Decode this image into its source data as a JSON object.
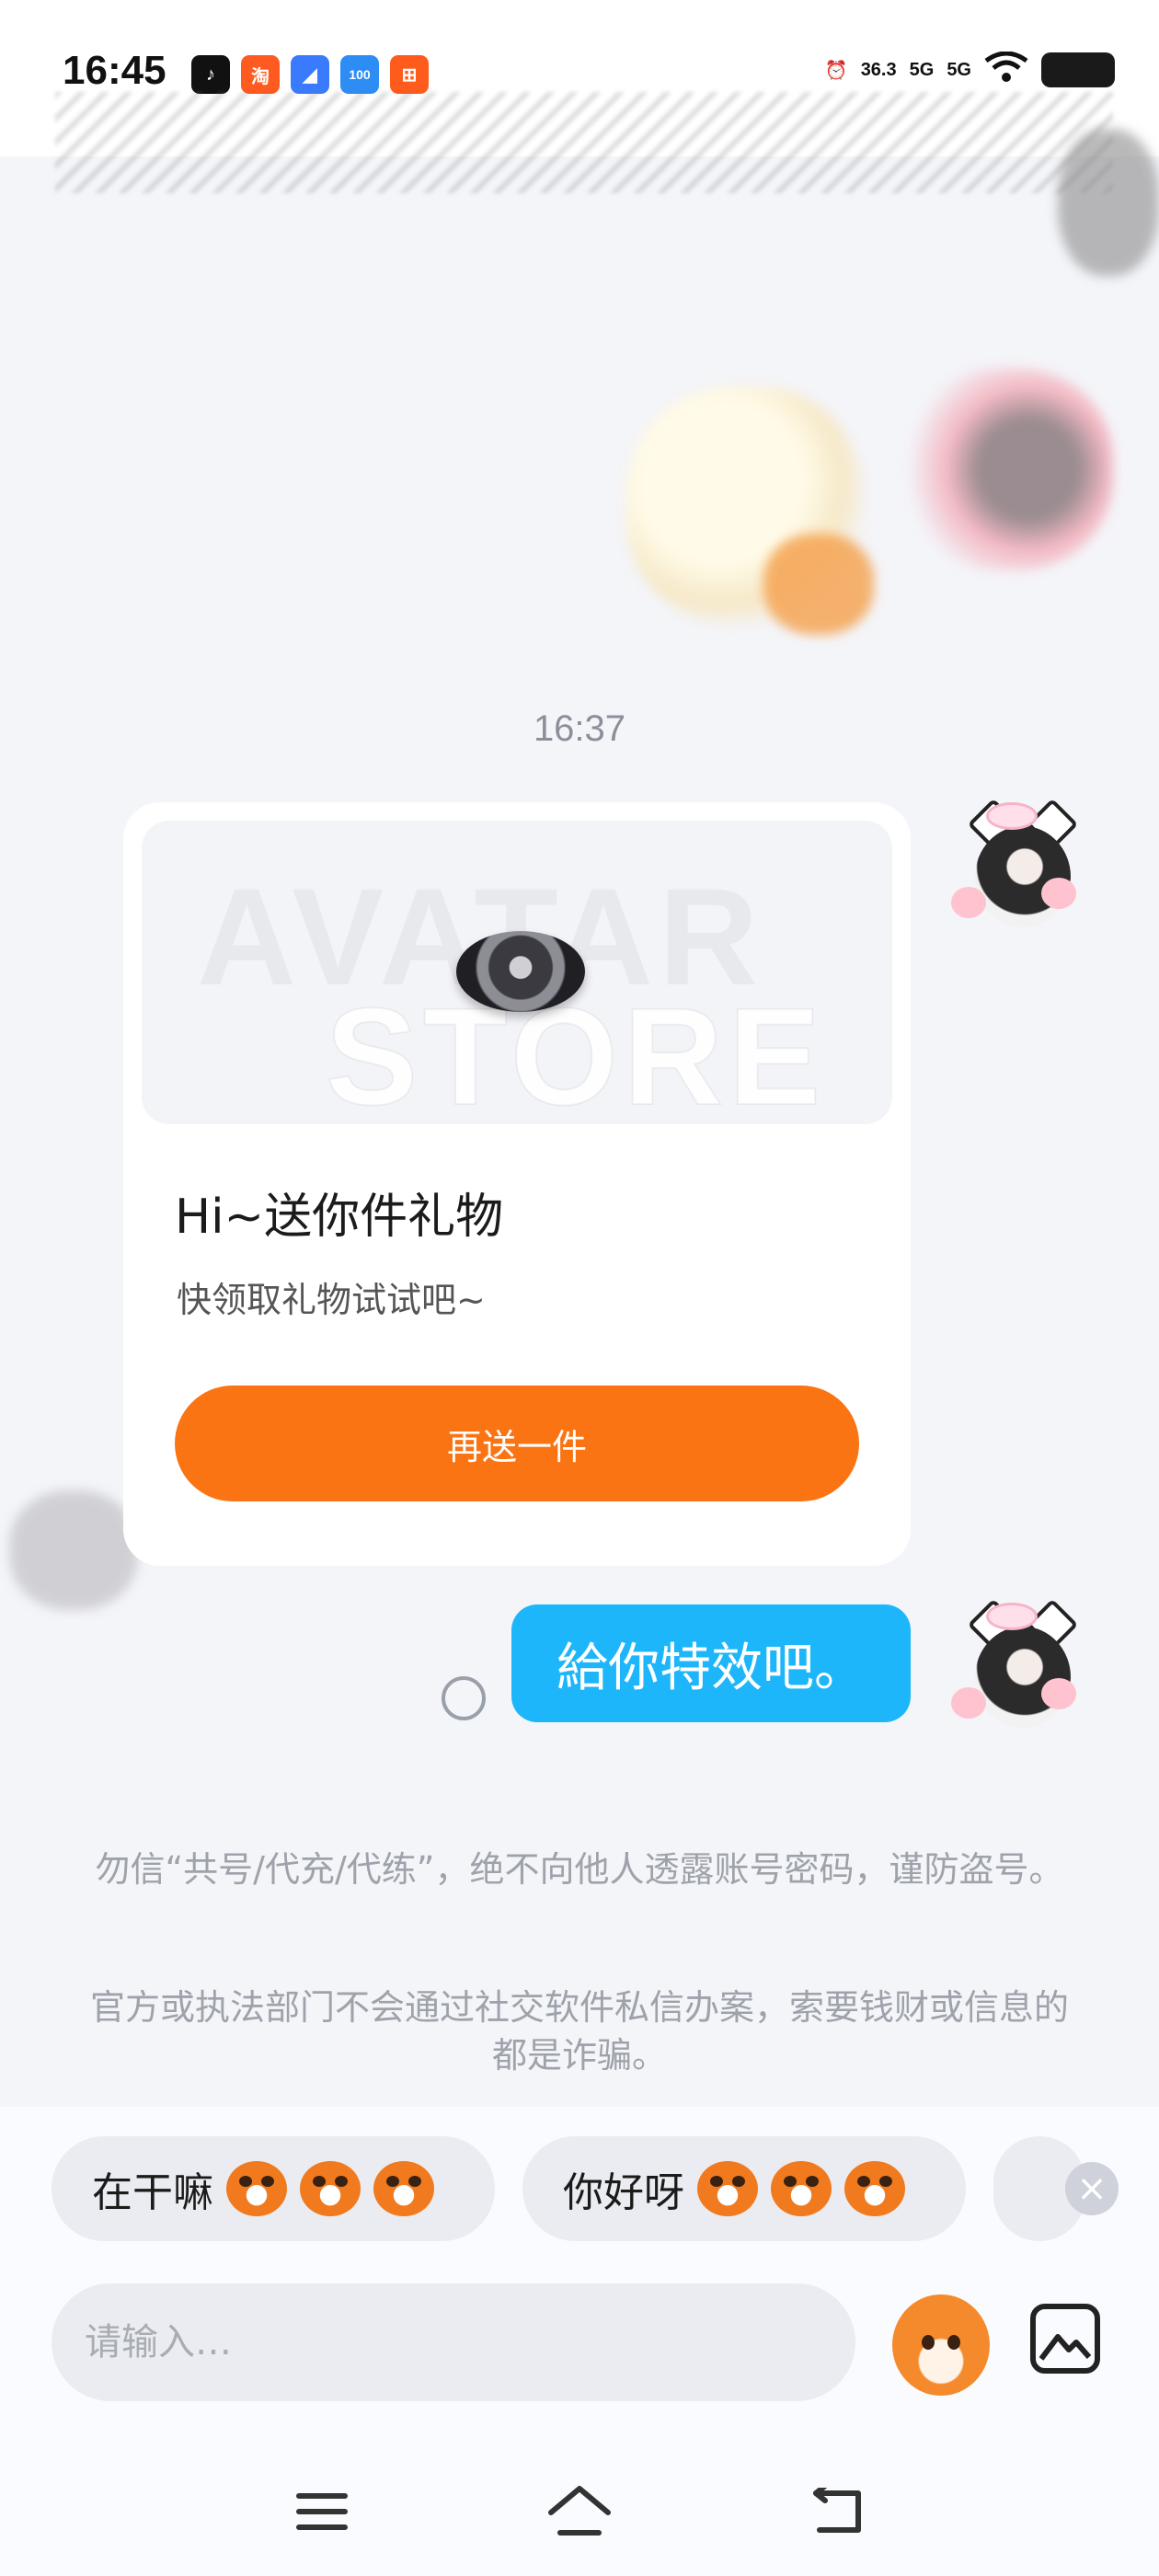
{
  "status_bar": {
    "time": "16:45",
    "app_icons": [
      {
        "name": "tiktok-icon",
        "glyph": "♪",
        "color": "#111111"
      },
      {
        "name": "taobao-icon",
        "glyph": "淘",
        "color": "#ff5a1f"
      },
      {
        "name": "blue-app-icon",
        "glyph": "◢",
        "color": "#3a7bfd"
      },
      {
        "name": "homework-app-icon",
        "glyph": "100",
        "color": "#2e8df5"
      },
      {
        "name": "orange-app-icon",
        "glyph": "⊞",
        "color": "#ff5b1c"
      }
    ],
    "network_speed": "36.3",
    "signal_1": "5G",
    "signal_2": "5G"
  },
  "chat": {
    "timestamp": "16:37",
    "gift_card": {
      "preview_watermark_line1": "AVATAR",
      "preview_watermark_line2": "STORE",
      "title": "Hi~送你件礼物",
      "subtitle": "快领取礼物试试吧~",
      "button_label": "再送一件"
    },
    "sent_message": "給你特效吧。"
  },
  "warnings": {
    "line1": "勿信“共号/代充/代练”，绝不向他人透露账号密码，谨防盗号。",
    "line2": "官方或执法部门不会通过社交软件私信办案，索要钱财或信息的都是诈骗。"
  },
  "quick_replies": [
    {
      "text": "在干嘛",
      "emoji_count": 3
    },
    {
      "text": "你好呀",
      "emoji_count": 3
    }
  ],
  "input": {
    "placeholder": "请输入…"
  },
  "colors": {
    "accent_orange": "#fb7414",
    "bubble_blue": "#1eb6fb"
  }
}
